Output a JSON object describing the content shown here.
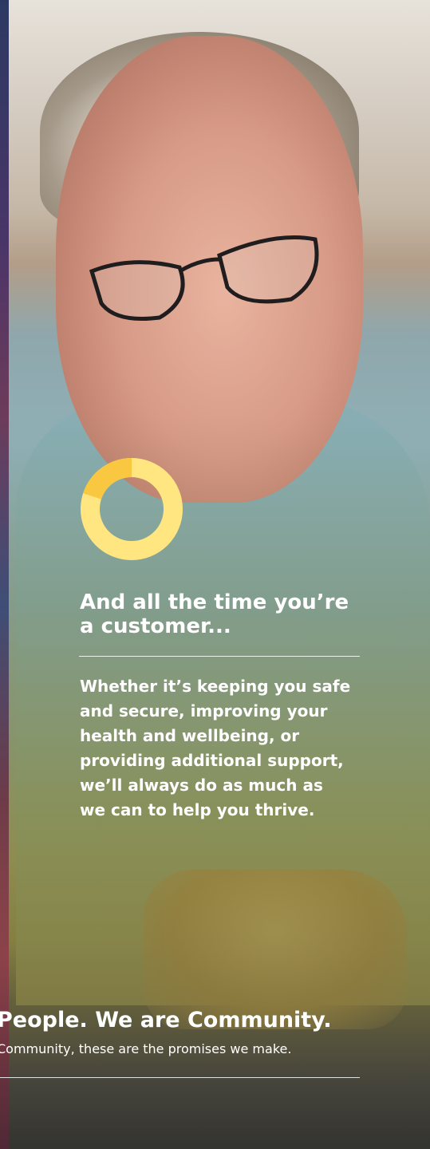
{
  "colors": {
    "accent_yellow": "#FFE680",
    "accent_yellow_dark": "#F9C840",
    "text": "#FFFFFF"
  },
  "donut_icon": {
    "name": "progress-ring-icon",
    "filled_fraction": 0.2
  },
  "headline": "And all the time you’re a customer...",
  "body": "Whether it’s keeping you safe and secure, improving your health and wellbeing, or providing additional support, we’ll always do as much as we can to help you thrive.",
  "tagline": "People. We are Community.",
  "subline": "Community, these are the promises we make."
}
